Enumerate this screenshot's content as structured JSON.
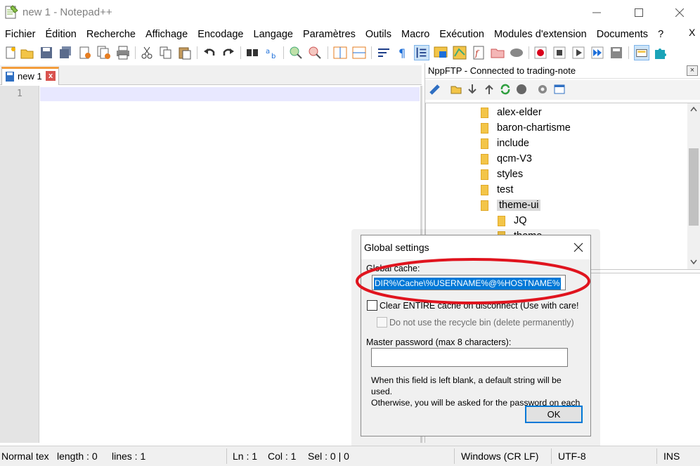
{
  "window": {
    "title": "new 1 - Notepad++"
  },
  "menu": {
    "items": [
      "Fichier",
      "Édition",
      "Recherche",
      "Affichage",
      "Encodage",
      "Langage",
      "Paramètres",
      "Outils",
      "Macro",
      "Exécution",
      "Modules d'extension",
      "Documents",
      "?"
    ],
    "close_glyph": "X"
  },
  "tabs": [
    {
      "label": "new 1",
      "close": "x"
    }
  ],
  "editor": {
    "line_number": "1",
    "content": ""
  },
  "ftp": {
    "title": "NppFTP - Connected to trading-note",
    "tree": [
      {
        "label": "alex-elder",
        "depth": 0
      },
      {
        "label": "baron-chartisme",
        "depth": 0
      },
      {
        "label": "include",
        "depth": 0
      },
      {
        "label": "qcm-V3",
        "depth": 0
      },
      {
        "label": "styles",
        "depth": 0
      },
      {
        "label": "test",
        "depth": 0
      },
      {
        "label": "theme-ui",
        "depth": 0,
        "selected": true
      },
      {
        "label": "JQ",
        "depth": 1
      },
      {
        "label": "theme",
        "depth": 1
      }
    ]
  },
  "dialog": {
    "title": "Global settings",
    "cache_label": "Global cache:",
    "cache_value": "DIR%\\Cache\\%USERNAME%@%HOSTNAME%",
    "clear_cache_label": "Clear ENTIRE cache on disconnect (Use with care!",
    "clear_cache_checked": false,
    "recycle_label": "Do not use the recycle bin (delete permanently)",
    "recycle_checked": false,
    "password_label": "Master password (max 8 characters):",
    "password_value": "",
    "note_line1": "When this field is left blank, a default string will be",
    "note_line2": "used.",
    "note_line3": "Otherwise, you will be asked for the password on each",
    "ok_label": "OK"
  },
  "status": {
    "type": "Normal tex",
    "length": "length : 0",
    "lines": "lines : 1",
    "ln": "Ln : 1",
    "col": "Col : 1",
    "sel": "Sel : 0 | 0",
    "eol": "Windows (CR LF)",
    "encoding": "UTF-8",
    "mode": "INS"
  },
  "colors": {
    "highlight_ellipse": "#e0141e",
    "selection": "#0078d7",
    "tab_accent": "#f39d3c"
  }
}
